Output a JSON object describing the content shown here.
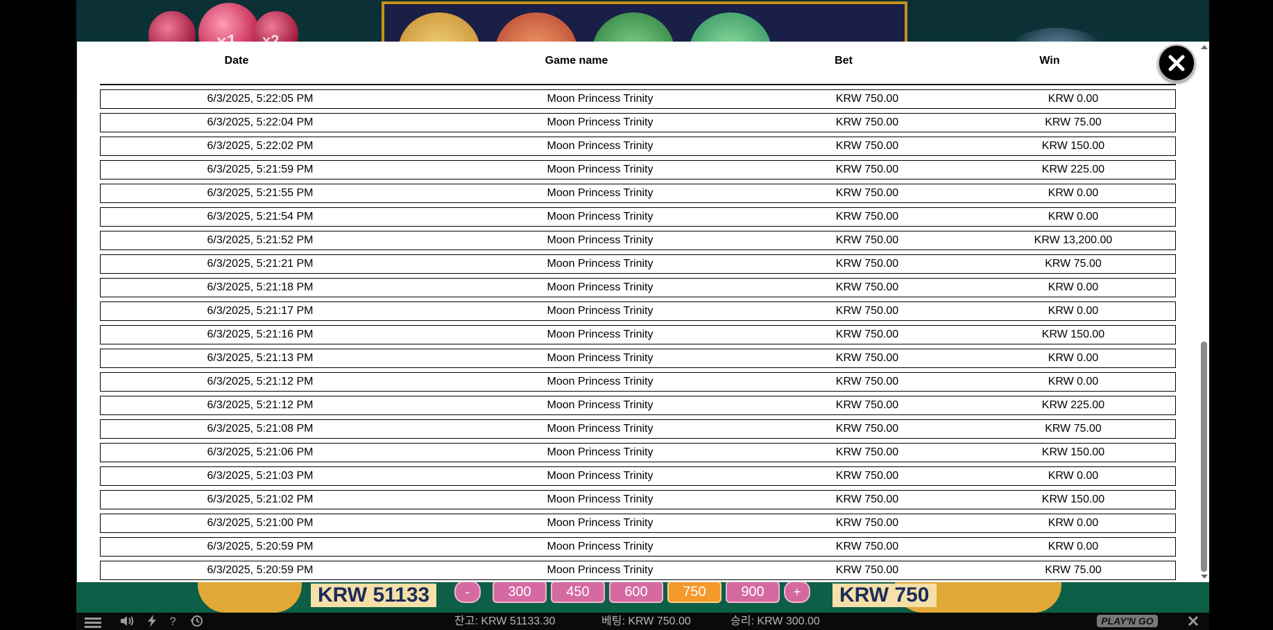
{
  "table": {
    "columns": {
      "date": "Date",
      "game_name": "Game name",
      "bet": "Bet",
      "win": "Win"
    },
    "rows": [
      {
        "date": "6/3/2025, 5:22:05 PM",
        "game": "Moon Princess Trinity",
        "bet": "KRW 750.00",
        "win": "KRW 0.00"
      },
      {
        "date": "6/3/2025, 5:22:04 PM",
        "game": "Moon Princess Trinity",
        "bet": "KRW 750.00",
        "win": "KRW 75.00"
      },
      {
        "date": "6/3/2025, 5:22:02 PM",
        "game": "Moon Princess Trinity",
        "bet": "KRW 750.00",
        "win": "KRW 150.00"
      },
      {
        "date": "6/3/2025, 5:21:59 PM",
        "game": "Moon Princess Trinity",
        "bet": "KRW 750.00",
        "win": "KRW 225.00"
      },
      {
        "date": "6/3/2025, 5:21:55 PM",
        "game": "Moon Princess Trinity",
        "bet": "KRW 750.00",
        "win": "KRW 0.00"
      },
      {
        "date": "6/3/2025, 5:21:54 PM",
        "game": "Moon Princess Trinity",
        "bet": "KRW 750.00",
        "win": "KRW 0.00"
      },
      {
        "date": "6/3/2025, 5:21:52 PM",
        "game": "Moon Princess Trinity",
        "bet": "KRW 750.00",
        "win": "KRW 13,200.00"
      },
      {
        "date": "6/3/2025, 5:21:21 PM",
        "game": "Moon Princess Trinity",
        "bet": "KRW 750.00",
        "win": "KRW 75.00"
      },
      {
        "date": "6/3/2025, 5:21:18 PM",
        "game": "Moon Princess Trinity",
        "bet": "KRW 750.00",
        "win": "KRW 0.00"
      },
      {
        "date": "6/3/2025, 5:21:17 PM",
        "game": "Moon Princess Trinity",
        "bet": "KRW 750.00",
        "win": "KRW 0.00"
      },
      {
        "date": "6/3/2025, 5:21:16 PM",
        "game": "Moon Princess Trinity",
        "bet": "KRW 750.00",
        "win": "KRW 150.00"
      },
      {
        "date": "6/3/2025, 5:21:13 PM",
        "game": "Moon Princess Trinity",
        "bet": "KRW 750.00",
        "win": "KRW 0.00"
      },
      {
        "date": "6/3/2025, 5:21:12 PM",
        "game": "Moon Princess Trinity",
        "bet": "KRW 750.00",
        "win": "KRW 0.00"
      },
      {
        "date": "6/3/2025, 5:21:12 PM",
        "game": "Moon Princess Trinity",
        "bet": "KRW 750.00",
        "win": "KRW 225.00"
      },
      {
        "date": "6/3/2025, 5:21:08 PM",
        "game": "Moon Princess Trinity",
        "bet": "KRW 750.00",
        "win": "KRW 75.00"
      },
      {
        "date": "6/3/2025, 5:21:06 PM",
        "game": "Moon Princess Trinity",
        "bet": "KRW 750.00",
        "win": "KRW 150.00"
      },
      {
        "date": "6/3/2025, 5:21:03 PM",
        "game": "Moon Princess Trinity",
        "bet": "KRW 750.00",
        "win": "KRW 0.00"
      },
      {
        "date": "6/3/2025, 5:21:02 PM",
        "game": "Moon Princess Trinity",
        "bet": "KRW 750.00",
        "win": "KRW 150.00"
      },
      {
        "date": "6/3/2025, 5:21:00 PM",
        "game": "Moon Princess Trinity",
        "bet": "KRW 750.00",
        "win": "KRW 0.00"
      },
      {
        "date": "6/3/2025, 5:20:59 PM",
        "game": "Moon Princess Trinity",
        "bet": "KRW 750.00",
        "win": "KRW 0.00"
      },
      {
        "date": "6/3/2025, 5:20:59 PM",
        "game": "Moon Princess Trinity",
        "bet": "KRW 750.00",
        "win": "KRW 75.00"
      }
    ]
  },
  "icons": {
    "close": "close-icon",
    "menu": "hamburger-menu-icon",
    "sound": "speaker-icon",
    "turbo": "lightning-icon",
    "help": "question-icon",
    "history": "history-icon",
    "exit": "close-icon"
  },
  "game": {
    "multipliers": [
      "x1",
      "x2"
    ],
    "balance_display": "KRW 51133",
    "bet_display": "KRW 750",
    "bet_minus": "-",
    "bet_plus": "+",
    "chips": [
      "300",
      "450",
      "600",
      "750",
      "900"
    ],
    "selected_chip": "750"
  },
  "status": {
    "balance": "잔고: KRW 51133.30",
    "bet": "베팅: KRW 750.00",
    "win": "승리: KRW 300.00",
    "logo": "PLAY'N GO"
  },
  "colors": {
    "modal_bg": "#ffffff",
    "game_bg": "#0e4a47",
    "chip": "#d46aa1",
    "chip_selected": "#f49a2a",
    "gold": "#e0a836"
  }
}
